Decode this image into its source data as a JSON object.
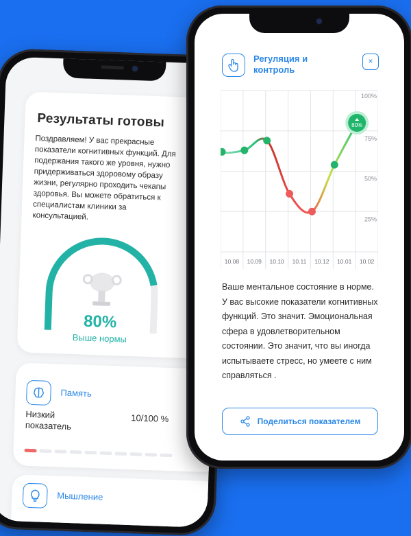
{
  "back_screen": {
    "title": "Результаты готовы",
    "text": "Поздравляем! У вас прекрасные показатели когнитивных функций. Для подержания такого же уровня, нужно придерживаться здоровому образу жизни, регулярно проходить чекапы здоровья. Вы можете обратиться к специалистам клиники за консультацией.",
    "result_percent": "80%",
    "result_progress": 0.8,
    "result_label": "Выше нормы",
    "memory": {
      "title": "Память",
      "level": "Низкий показатель",
      "score": "10/100 %",
      "dots_total": 10,
      "dots_active": 1
    },
    "thinking": {
      "title": "Мышление"
    },
    "colors": {
      "accent": "#23b3a6",
      "link": "#2a87e8",
      "alert": "#ef6766"
    }
  },
  "front_screen": {
    "title": "Регуляция и контроль",
    "close_label": "×",
    "description": "Ваше ментальное состояние в норме. У вас высокие показатели когнитивных функций. Это значит. Эмоциональная сфера в удовлетворительном состоянии. Это значит, что вы иногда испытываете стресс, но умеете с ним справляться .",
    "share_label": "Поделиться показателем",
    "icons": {
      "header": "hand-touch-icon",
      "close": "close-icon",
      "share": "share-icon"
    }
  },
  "chart_data": {
    "type": "line",
    "categories": [
      "10.08",
      "10.09",
      "10.10",
      "10.11",
      "10.12",
      "10.01",
      "10.02"
    ],
    "values": [
      62,
      63,
      69,
      36,
      25,
      54,
      80
    ],
    "y_ticks": [
      "100%",
      "75%",
      "50%",
      "25%"
    ],
    "ylim": [
      0,
      100
    ],
    "highlight_label": "80%",
    "grid": true,
    "colors": {
      "high": "#23c07a",
      "low": "#ef4c4c",
      "mid": "#c6e04a"
    }
  }
}
